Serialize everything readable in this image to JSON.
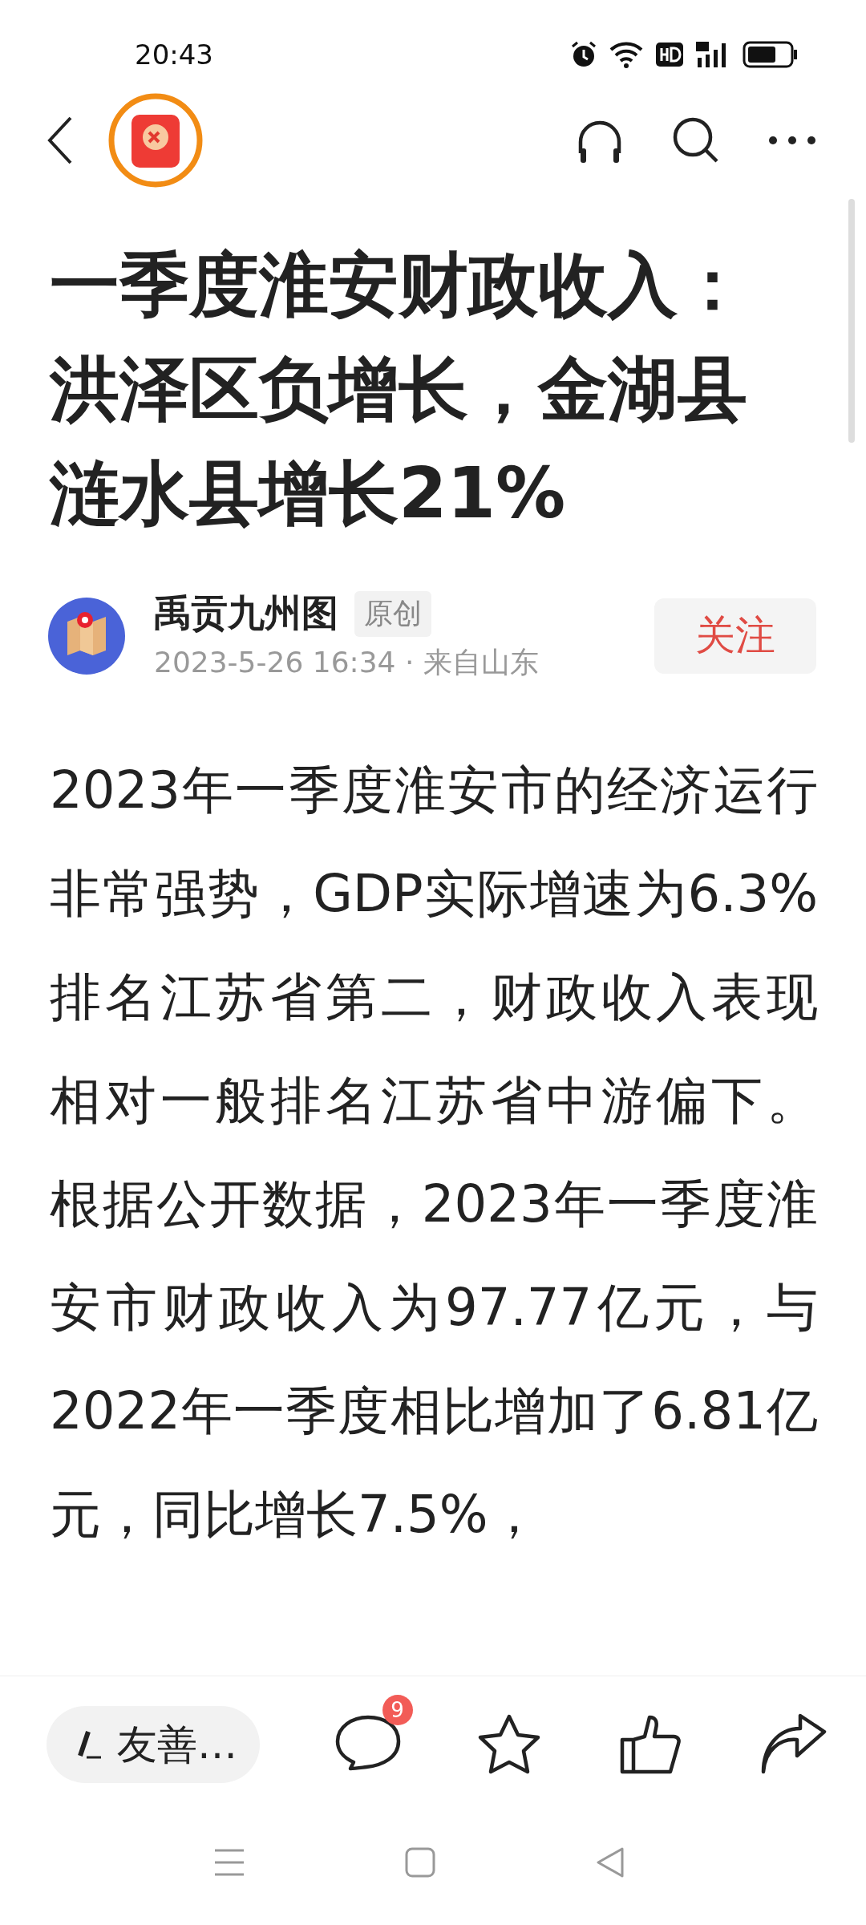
{
  "status_bar": {
    "time": "20:43"
  },
  "article": {
    "title": "一季度淮安财政收入：洪泽区负增长，金湖县涟水县增长21%",
    "author": {
      "name": "禹贡九州图",
      "badge": "原创",
      "meta": "2023-5-26 16:34 · 来自山东",
      "follow": "关注"
    },
    "body": "2023年一季度淮安市的经济运行非常强势，GDP实际增速为6.3%排名江苏省第二，财政收入表现相对一般排名江苏省中游偏下。根据公开数据，2023年一季度淮安市财政收入为97.77亿元，与2022年一季度相比增加了6.81亿元，同比增长7.5%，"
  },
  "bottom_bar": {
    "comment_field": "友善…",
    "comment_count": "9"
  }
}
